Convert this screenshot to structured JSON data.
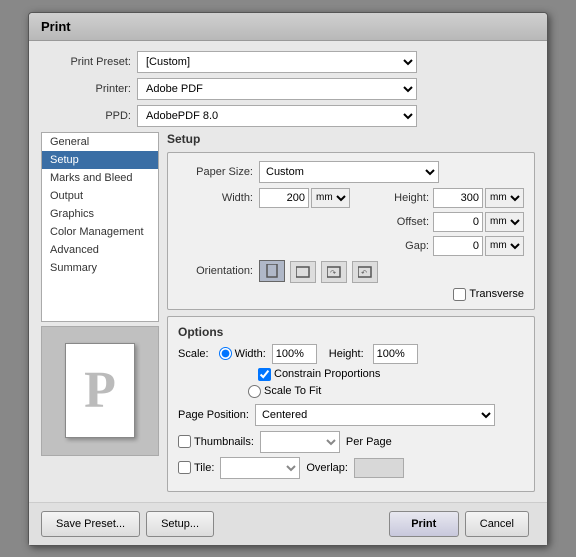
{
  "dialog": {
    "title": "Print"
  },
  "presets": {
    "print_preset_label": "Print Preset:",
    "print_preset_value": "[Custom]",
    "printer_label": "Printer:",
    "printer_value": "Adobe PDF",
    "ppd_label": "PPD:",
    "ppd_value": "AdobePDF 8.0"
  },
  "nav": {
    "items": [
      {
        "label": "General",
        "active": false
      },
      {
        "label": "Setup",
        "active": true
      },
      {
        "label": "Marks and Bleed",
        "active": false
      },
      {
        "label": "Output",
        "active": false
      },
      {
        "label": "Graphics",
        "active": false
      },
      {
        "label": "Color Management",
        "active": false
      },
      {
        "label": "Advanced",
        "active": false
      },
      {
        "label": "Summary",
        "active": false
      }
    ]
  },
  "setup": {
    "section_label": "Setup",
    "paper_size_label": "Paper Size:",
    "paper_size_value": "Custom",
    "width_label": "Width:",
    "width_value": "200 mm",
    "width_unit": "mm",
    "height_label": "Height:",
    "height_value": "300 mm",
    "height_unit": "mm",
    "offset_label": "Offset:",
    "offset_value": "0 mm",
    "gap_label": "Gap:",
    "gap_value": "0 mm",
    "orientation_label": "Orientation:",
    "transverse_label": "Transverse"
  },
  "options": {
    "section_label": "Options",
    "scale_label": "Scale:",
    "width_radio": "Width:",
    "width_pct": "100%",
    "height_label": "Height:",
    "height_pct": "100%",
    "constrain_label": "Constrain Proportions",
    "scale_to_fit_label": "Scale To Fit",
    "page_position_label": "Page Position:",
    "page_position_value": "Centered",
    "thumbnails_label": "Thumbnails:",
    "thumbnails_per_page": "Per Page",
    "tile_label": "Tile:",
    "overlap_label": "Overlap:"
  },
  "buttons": {
    "save_preset": "Save Preset...",
    "setup": "Setup...",
    "print": "Print",
    "cancel": "Cancel"
  }
}
